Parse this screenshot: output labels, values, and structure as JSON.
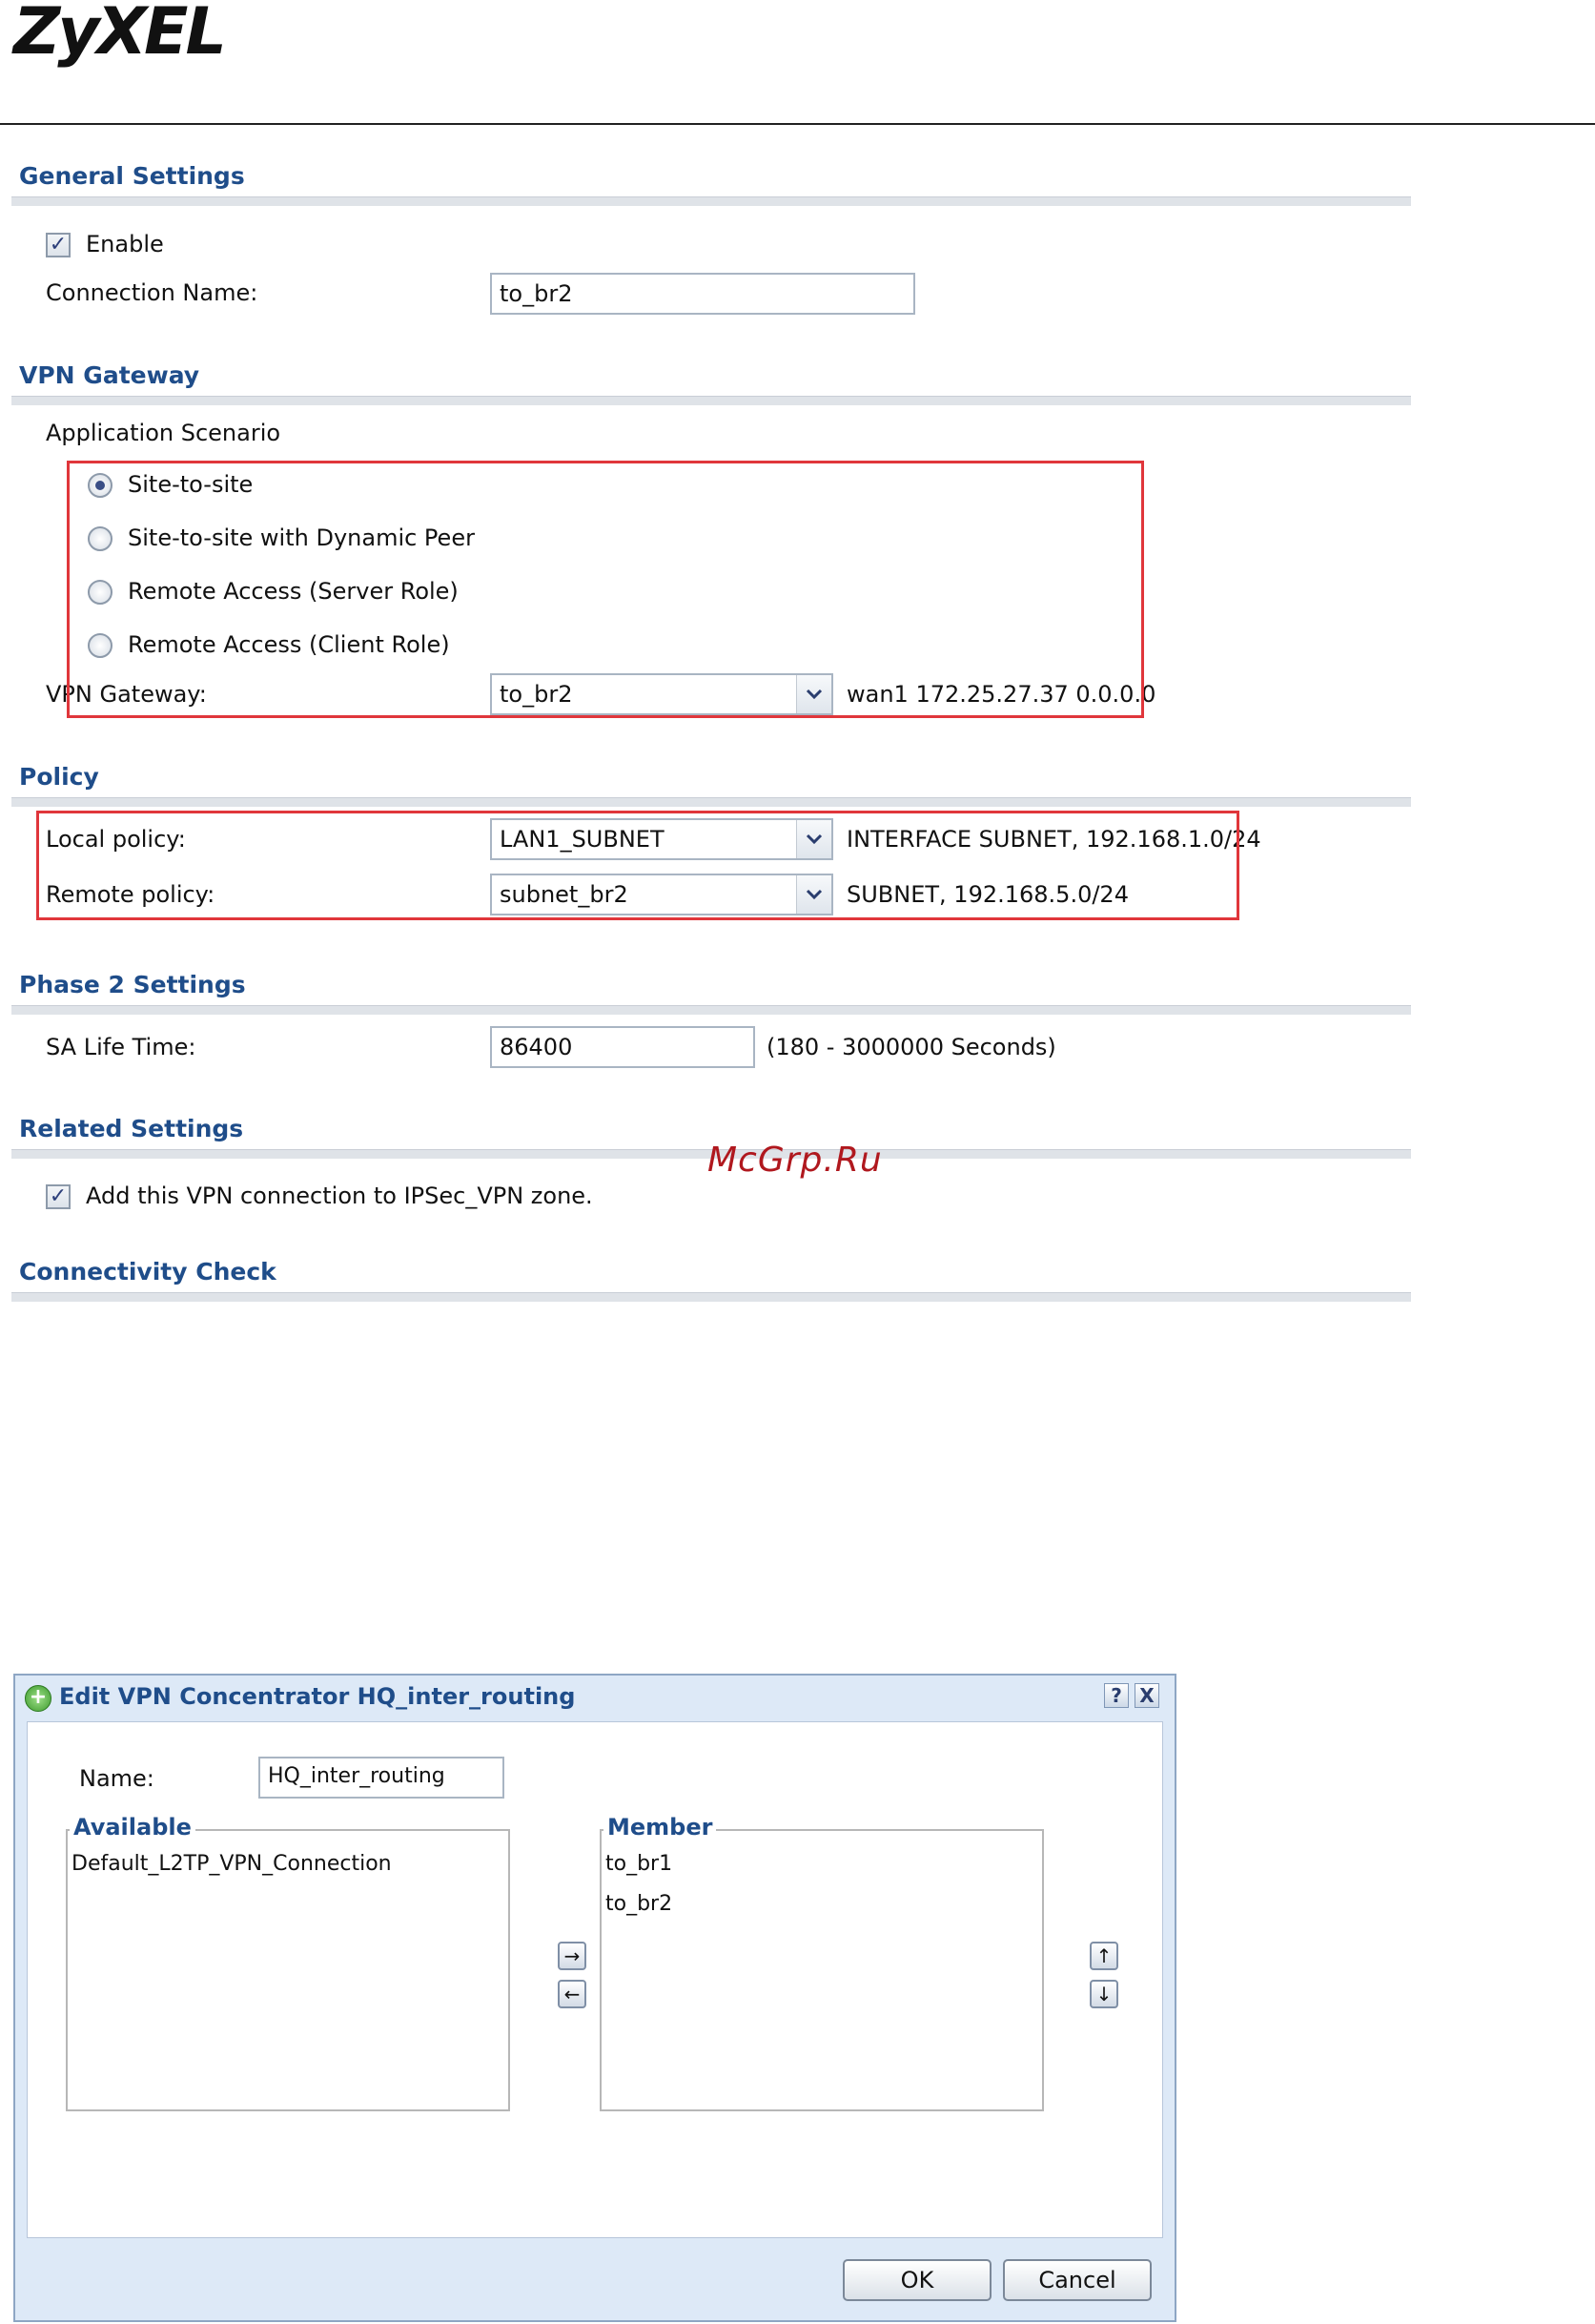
{
  "brand": {
    "logo": "ZyXEL"
  },
  "watermark": "McGrp.Ru",
  "general": {
    "title": "General Settings",
    "enable_label": "Enable",
    "connection_name_label": "Connection Name:",
    "connection_name_value": "to_br2"
  },
  "vpn_gateway": {
    "title": "VPN Gateway",
    "scenario_label": "Application Scenario",
    "options": [
      "Site-to-site",
      "Site-to-site with Dynamic Peer",
      "Remote Access (Server Role)",
      "Remote Access (Client Role)"
    ],
    "selected_index": 0,
    "gateway_label": "VPN Gateway:",
    "gateway_value": "to_br2",
    "gateway_info": "wan1 172.25.27.37 0.0.0.0"
  },
  "policy": {
    "title": "Policy",
    "local_label": "Local policy:",
    "local_value": "LAN1_SUBNET",
    "local_info": "INTERFACE SUBNET, 192.168.1.0/24",
    "remote_label": "Remote policy:",
    "remote_value": "subnet_br2",
    "remote_info": "SUBNET, 192.168.5.0/24"
  },
  "phase2": {
    "title": "Phase 2 Settings",
    "sa_label": "SA Life Time:",
    "sa_value": "86400",
    "sa_hint": "(180 - 3000000 Seconds)"
  },
  "related": {
    "title": "Related Settings",
    "zone_label": "Add this VPN connection to IPSec_VPN zone."
  },
  "connectivity": {
    "title": "Connectivity Check"
  },
  "dialog": {
    "title": "Edit VPN Concentrator HQ_inter_routing",
    "help_icon": "?",
    "close_icon": "X",
    "name_label": "Name:",
    "name_value": "HQ_inter_routing",
    "available_legend": "Available",
    "available_items": [
      "Default_L2TP_VPN_Connection"
    ],
    "member_legend": "Member",
    "member_items": [
      "to_br1",
      "to_br2"
    ],
    "ok_label": "OK",
    "cancel_label": "Cancel"
  }
}
